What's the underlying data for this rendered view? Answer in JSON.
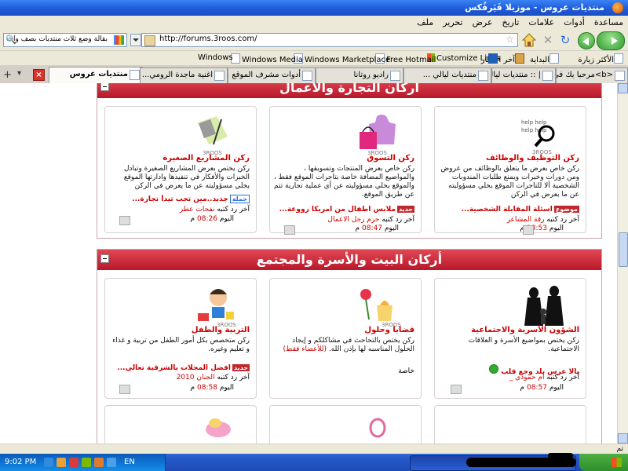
{
  "window": {
    "title": "منتديات عروس - موزيلا فَيَرفُكس"
  },
  "menu": [
    "ملف",
    "تحرير",
    "عرض",
    "تاريخ",
    "علامات",
    "أدوات",
    "مساعدة"
  ],
  "navigation": {
    "url": "http://forums.3roos.com/",
    "search_text": "بقالة وضع ثلاث منتديات بصف واحد"
  },
  "bookmarks": [
    "الأكثر زيارة",
    "البداية",
    "آخر الأخبار",
    "Customize Links",
    "Free Hotmail",
    "Windows Marketplace",
    "Windows Media",
    "Windows"
  ],
  "tabs": [
    {
      "label": "منتديات عروس",
      "active": true
    },
    {
      "label": "اغنية ماجدة الرومي..."
    },
    {
      "label": "أدوات مشرف الموقع ..."
    },
    {
      "label": "راديو روتانا"
    },
    {
      "label": "منتديات ليالي ..."
    },
    {
      "label": "| :: منتديات ليالي"
    },
    {
      "label": "<b>مرحبا بك في لو..."
    }
  ],
  "sections": [
    {
      "title": "أركان التجارة والأعمال",
      "cards": [
        {
          "title": "ركن التوظيف والوظائف",
          "desc": "ركن خاص بعرض ما يتعلق بالوظائف من عروض ومن دورات وخبرات ويمنع طلبات المندوبات الشخصية ألا للتاجرات الموقع يخلي مسؤوليته عن ما يعرض في الركن",
          "last_tag": "موضوع",
          "last": "أسئلة المقابلة الشخصية...",
          "by_prefix": "آخر رد كتبه",
          "by": "رقة المشاعر",
          "day": "اليوم",
          "time": "08:53",
          "ampm": "م"
        },
        {
          "title": "ركن التسوق",
          "desc": "ركن خاص بعرض المنتجات وتسويقها ، والمواضيع المضافة خاصة بتاجرات الموقع فقط ، والموقع يخلي مسؤوليته عن أي عملية تجارية تتم عن طريق الموقع.",
          "last_tag": "جديد",
          "last": "ملابس أطفال من امريكا رووعة...",
          "by_prefix": "آخر رد كتبه",
          "by": "حرم رجل الاعمال",
          "day": "اليوم",
          "time": "08:47",
          "ampm": "م"
        },
        {
          "title": "ركن المشاريع الصغيرة",
          "desc": "ركن يختص بعرض المشاريع الصغيرة وتبادل الخبرات والأفكار في تنفيذها وادارتها الموقع يخلي مسؤوليته عن ما يعرض في الركن",
          "last_tag": "جملة",
          "last": "جديد..مين تحب تبدأ تجارة...",
          "by_prefix": "آخر رد كتبه",
          "by": "نفحات عطر",
          "day": "اليوم",
          "time": "08:26",
          "ampm": "م"
        }
      ]
    },
    {
      "title": "أركان البيت والأسرة والمجتمع",
      "cards": [
        {
          "title": "الشؤون الأسرية والاجتماعية",
          "desc": "ركن يختص بمواضيع الأسرة و العلاقات الاجتماعية.",
          "last": "يالا عرس بلد وجع قلب",
          "by_prefix": "آخر رد كتبه",
          "by": "ام حمودي _",
          "day": "اليوم",
          "time": "08:57",
          "ampm": "م"
        },
        {
          "title": "قضايا وحلول",
          "desc": "ركن يختص بالتحاحث في مشاكلكم و إيجاد الحلول المناسبه لها بإذن الله.",
          "desc_note": "(للأعضاء فقط)",
          "last": "خاصة"
        },
        {
          "title": "التربية والطفل",
          "desc": "ركن متخصص بكل أمور الطفل من تربية و غذاء و تعليم وغيره.",
          "last_tag": "جديد",
          "last": "افضل المحلات بالشرقية تعالي...",
          "by_prefix": "آخر رد كتبه",
          "by": "الجنان 2010",
          "day": "اليوم",
          "time": "08:58",
          "ampm": "م"
        }
      ]
    }
  ],
  "status": {
    "text": "تم"
  },
  "taskbar": {
    "clock": "9:02 PM",
    "lang": "EN"
  },
  "colors": {
    "accent": "#c1272d",
    "titlebar": "#1c58d8",
    "header_bar": "#c8202f"
  }
}
